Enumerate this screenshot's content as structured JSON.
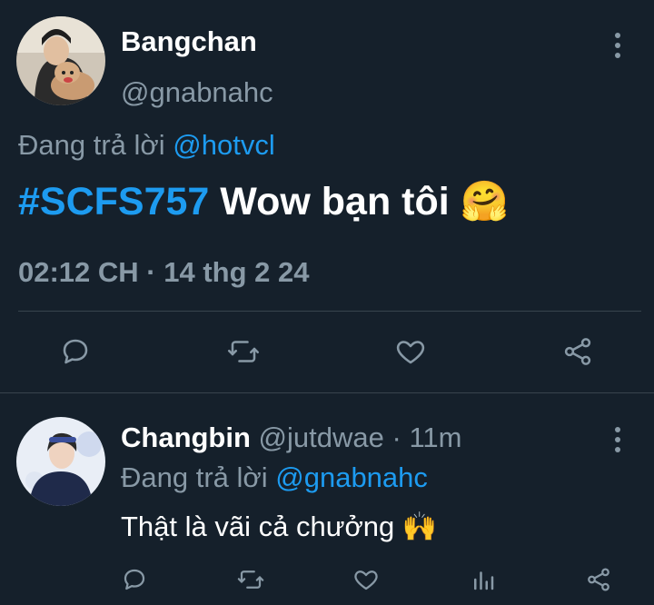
{
  "tweet": {
    "display_name": "Bangchan",
    "handle": "@gnabnahc",
    "replying_prefix": "Đang trả lời",
    "replying_to": "@hotvcl",
    "hashtag": "#SCFS757",
    "text": "Wow bạn tôi",
    "emoji": "🤗",
    "timestamp": "02:12 CH · 14 thg 2 24"
  },
  "reply": {
    "display_name": "Changbin",
    "handle": "@jutdwae",
    "separator": "·",
    "time": "11m",
    "replying_prefix": "Đang trả lời",
    "replying_to": "@gnabnahc",
    "text": "Thật là vãi cả chưởng",
    "emoji": "🙌"
  },
  "colors": {
    "background": "#15202b",
    "text": "#ffffff",
    "muted": "#8899a6",
    "link": "#1d9bf0",
    "divider": "#38444d"
  },
  "icons": {
    "more": "more-vertical-icon",
    "reply": "reply-icon",
    "retweet": "retweet-icon",
    "like": "heart-icon",
    "analytics": "analytics-icon",
    "share": "share-icon"
  }
}
